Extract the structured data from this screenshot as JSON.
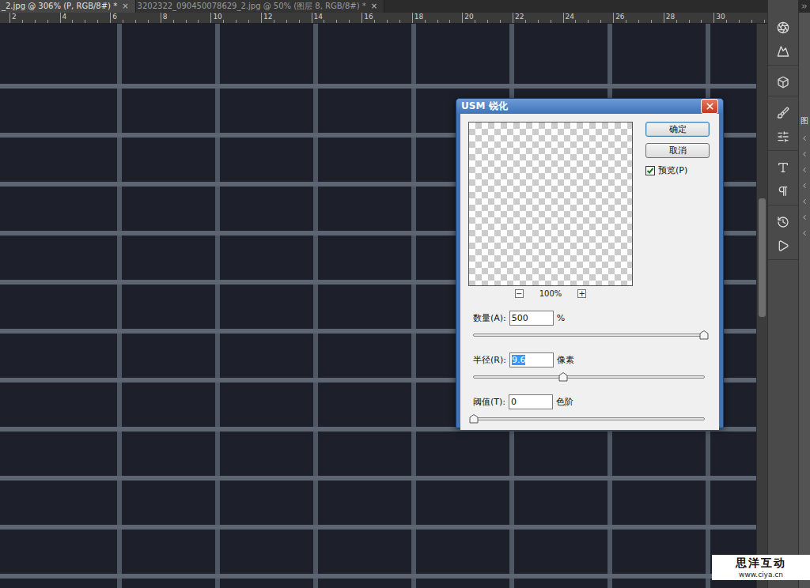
{
  "document_tabs": [
    {
      "label": "_2.jpg @ 306% (P, RGB/8#) *",
      "close": "×",
      "selected": true
    },
    {
      "label": "3202322_090450078629_2.jpg @ 50% (图层 8, RGB/8#) *",
      "close": "×",
      "selected": false
    }
  ],
  "ruler": {
    "ticks": [
      "2",
      "4",
      "6",
      "8",
      "10",
      "12",
      "14",
      "16",
      "18",
      "20",
      "22",
      "24",
      "26",
      "28",
      "30"
    ]
  },
  "vertical_scrollbar": {
    "thumb_start": 0.31,
    "thumb_size": 0.21
  },
  "side_panel": {
    "label": "图"
  },
  "dialog": {
    "title": "USM 锐化",
    "preview": {
      "zoom": "100%",
      "zoom_out": "−",
      "zoom_in": "+"
    },
    "buttons": [
      {
        "label": "确定",
        "default": true
      },
      {
        "label": "取消",
        "default": false
      }
    ],
    "preview_checkbox": {
      "label": "预览(P)",
      "checked": true
    },
    "fields": [
      {
        "label": "数量(A):",
        "value": "500",
        "unit": "%",
        "level": 1,
        "focused": false
      },
      {
        "label": "半径(R):",
        "value": "9.6",
        "unit": "像素",
        "level": 0.39,
        "focused": true
      },
      {
        "label": "阈值(T):",
        "value": "0",
        "unit": "色阶",
        "level": 0,
        "focused": false
      }
    ]
  },
  "watermark": {
    "title": "思洋互动",
    "url": "www.ciya.cn"
  }
}
